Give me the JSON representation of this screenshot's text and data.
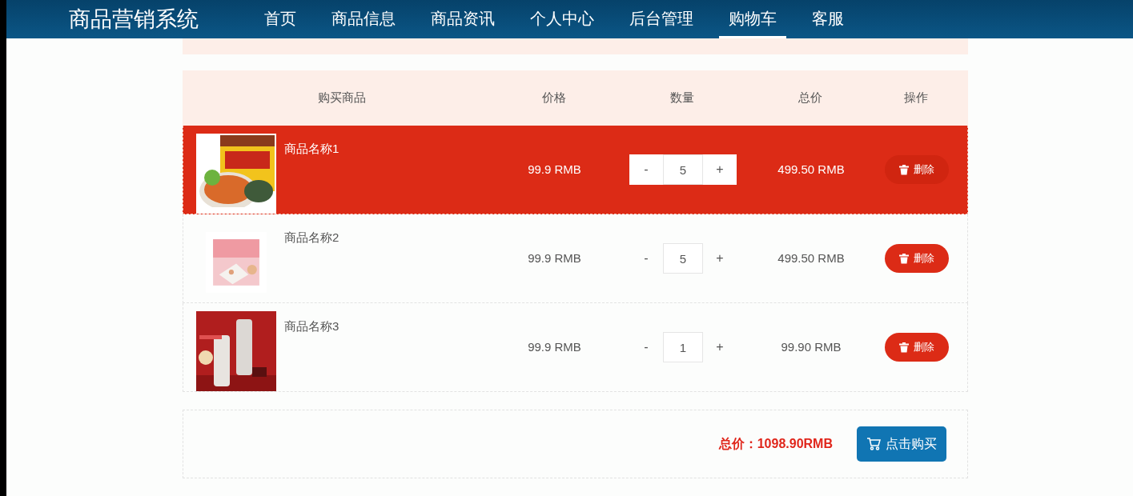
{
  "navbar": {
    "brand": "商品营销系统",
    "items": [
      {
        "label": "首页",
        "selected": false
      },
      {
        "label": "商品信息",
        "selected": false
      },
      {
        "label": "商品资讯",
        "selected": false
      },
      {
        "label": "个人中心",
        "selected": false
      },
      {
        "label": "后台管理",
        "selected": false
      },
      {
        "label": "购物车",
        "selected": true
      },
      {
        "label": "客服",
        "selected": false
      }
    ]
  },
  "table": {
    "columns": [
      "购买商品",
      "价格",
      "数量",
      "总价",
      "操作"
    ],
    "rows": [
      {
        "name": "商品名称1",
        "price": "99.9 RMB",
        "minus": "-",
        "quantity": "5",
        "plus": "+",
        "total": "499.50 RMB",
        "action": "删除",
        "highlighted": true
      },
      {
        "name": "商品名称2",
        "price": "99.9 RMB",
        "minus": "-",
        "quantity": "5",
        "plus": "+",
        "total": "499.50 RMB",
        "action": "删除",
        "highlighted": false
      },
      {
        "name": "商品名称3",
        "price": "99.9 RMB",
        "minus": "-",
        "quantity": "1",
        "plus": "+",
        "total": "99.90 RMB",
        "action": "删除",
        "highlighted": false
      }
    ]
  },
  "footer": {
    "total": "总价：1098.90RMB",
    "buy_button": "点击购买"
  }
}
